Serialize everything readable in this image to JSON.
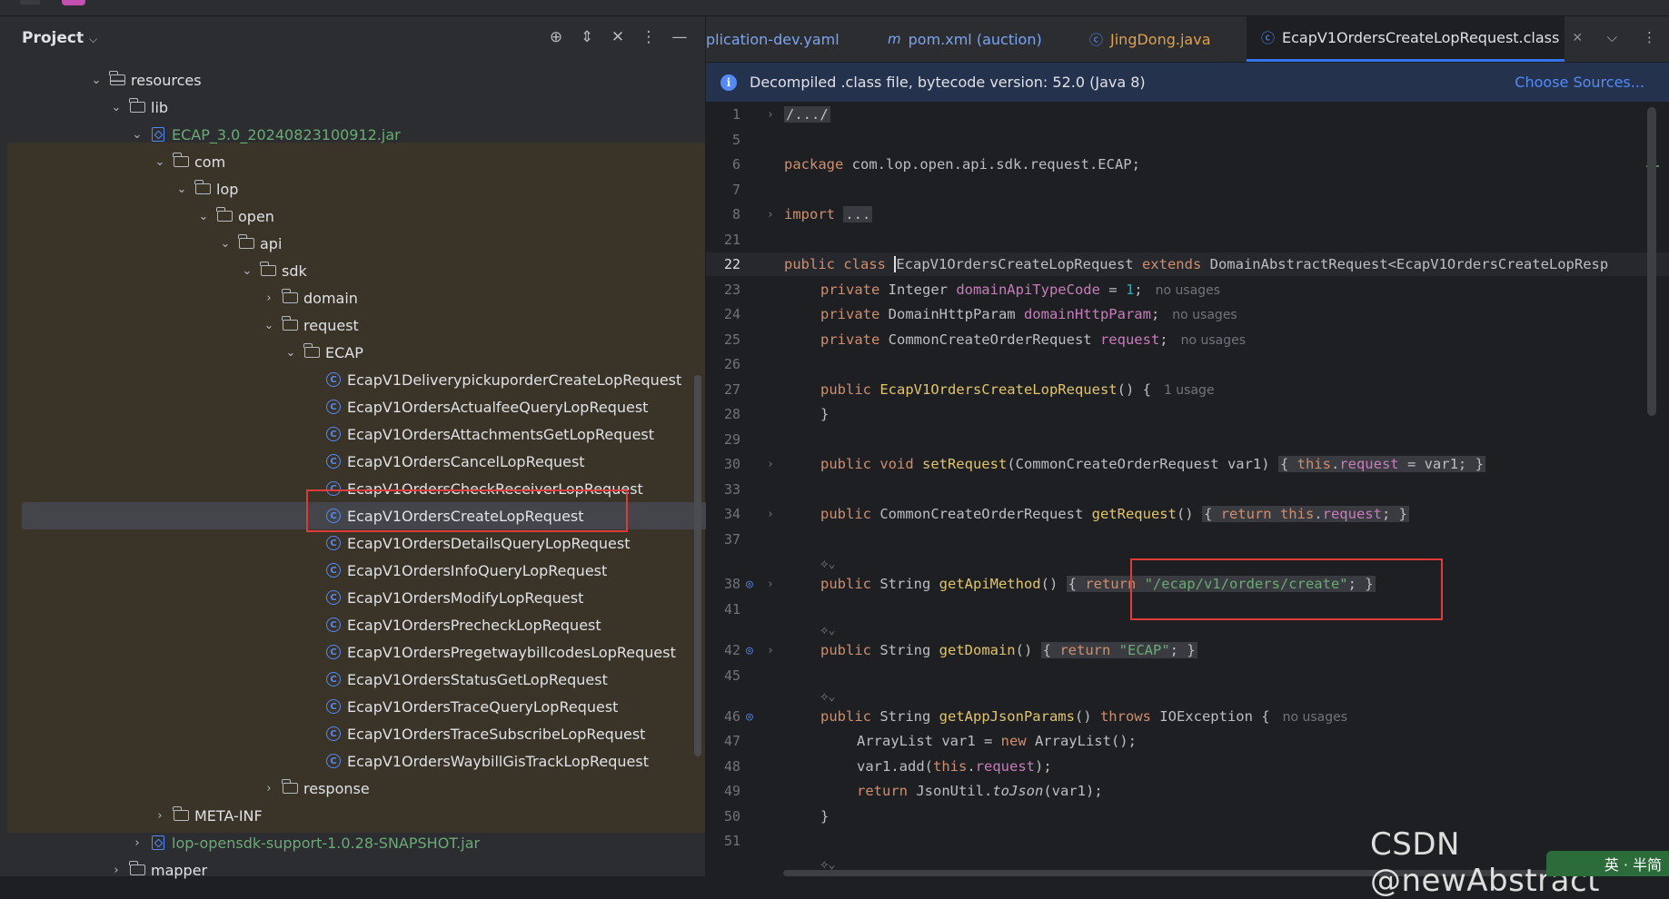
{
  "project_panel": {
    "title": "Project",
    "tree": [
      {
        "label": "resources",
        "icon": "resources-folder-icon",
        "expanded": true
      },
      {
        "label": "lib",
        "icon": "folder-icon",
        "expanded": true
      },
      {
        "label": "ECAP_3.0_20240823100912.jar",
        "icon": "jar-icon",
        "expanded": true
      },
      {
        "label": "com",
        "icon": "folder-icon",
        "expanded": true
      },
      {
        "label": "lop",
        "icon": "folder-icon",
        "expanded": true
      },
      {
        "label": "open",
        "icon": "folder-icon",
        "expanded": true
      },
      {
        "label": "api",
        "icon": "folder-icon",
        "expanded": true
      },
      {
        "label": "sdk",
        "icon": "folder-icon",
        "expanded": true
      },
      {
        "label": "domain",
        "icon": "folder-icon",
        "expanded": false
      },
      {
        "label": "request",
        "icon": "folder-icon",
        "expanded": true
      },
      {
        "label": "ECAP",
        "icon": "folder-icon",
        "expanded": true
      },
      {
        "label": "EcapV1DeliverypickuporderCreateLopRequest",
        "icon": "class-icon"
      },
      {
        "label": "EcapV1OrdersActualfeeQueryLopRequest",
        "icon": "class-icon"
      },
      {
        "label": "EcapV1OrdersAttachmentsGetLopRequest",
        "icon": "class-icon"
      },
      {
        "label": "EcapV1OrdersCancelLopRequest",
        "icon": "class-icon"
      },
      {
        "label": "EcapV1OrdersCheckReceiverLopRequest",
        "icon": "class-icon"
      },
      {
        "label": "EcapV1OrdersCreateLopRequest",
        "icon": "class-icon",
        "selected": true
      },
      {
        "label": "EcapV1OrdersDetailsQueryLopRequest",
        "icon": "class-icon"
      },
      {
        "label": "EcapV1OrdersInfoQueryLopRequest",
        "icon": "class-icon"
      },
      {
        "label": "EcapV1OrdersModifyLopRequest",
        "icon": "class-icon"
      },
      {
        "label": "EcapV1OrdersPrecheckLopRequest",
        "icon": "class-icon"
      },
      {
        "label": "EcapV1OrdersPregetwaybillcodesLopRequest",
        "icon": "class-icon"
      },
      {
        "label": "EcapV1OrdersStatusGetLopRequest",
        "icon": "class-icon"
      },
      {
        "label": "EcapV1OrdersTraceQueryLopRequest",
        "icon": "class-icon"
      },
      {
        "label": "EcapV1OrdersTraceSubscribeLopRequest",
        "icon": "class-icon"
      },
      {
        "label": "EcapV1OrdersWaybillGisTrackLopRequest",
        "icon": "class-icon"
      },
      {
        "label": "response",
        "icon": "folder-icon",
        "expanded": false
      },
      {
        "label": "META-INF",
        "icon": "folder-icon",
        "expanded": false
      },
      {
        "label": "lop-opensdk-support-1.0.28-SNAPSHOT.jar",
        "icon": "jar-icon",
        "expanded": false
      },
      {
        "label": "mapper",
        "icon": "folder-icon",
        "expanded": false
      }
    ]
  },
  "editor": {
    "tabs": [
      {
        "label": "plication-dev.yaml",
        "icon": ""
      },
      {
        "label": "pom.xml (auction)",
        "icon": "maven-icon"
      },
      {
        "label": "JingDong.java",
        "icon": "class-icon"
      },
      {
        "label": "EcapV1OrdersCreateLopRequest.class",
        "icon": "class-icon",
        "active": true
      }
    ],
    "banner_text": "Decompiled .class file, bytecode version: 52.0 (Java 8)",
    "banner_link": "Choose Sources...",
    "line_numbers": [
      "1",
      "5",
      "6",
      "7",
      "8",
      "21",
      "22",
      "23",
      "24",
      "25",
      "26",
      "27",
      "28",
      "29",
      "30",
      "33",
      "34",
      "37",
      "38",
      "41",
      "42",
      "45",
      "46",
      "47",
      "48",
      "49",
      "50",
      "51"
    ],
    "code": {
      "l1": "/.../",
      "l6_kw": "package",
      "l6_rest": " com.lop.open.api.sdk.request.ECAP;",
      "l8_kw": "import",
      "l8_fold": "...",
      "l22_kw": "public class ",
      "l22_name": "EcapV1OrdersCreateLopRequest",
      "l22_ext": " extends ",
      "l22_rest": "DomainAbstractRequest<EcapV1OrdersCreateLopResp",
      "l23_kw": "private ",
      "l23_type": "Integer ",
      "l23_field": "domainApiTypeCode",
      "l23_eq": " = ",
      "l23_num": "1",
      "l23_semi": ";",
      "l23_hint": "no usages",
      "l24_kw": "private ",
      "l24_type": "DomainHttpParam ",
      "l24_field": "domainHttpParam",
      "l24_semi": ";",
      "l24_hint": "no usages",
      "l25_kw": "private ",
      "l25_type": "CommonCreateOrderRequest ",
      "l25_field": "request",
      "l25_semi": ";",
      "l25_hint": "no usages",
      "l27_kw": "public ",
      "l27_fn": "EcapV1OrdersCreateLopRequest",
      "l27_rest": "() {",
      "l27_hint": "1 usage",
      "l28": "}",
      "l30_kw": "public void ",
      "l30_fn": "setRequest",
      "l30_args": "(CommonCreateOrderRequest var1) ",
      "l30_body_open": "{ ",
      "l30_this": "this",
      "l30_dot": ".",
      "l30_field": "request",
      "l30_tail": " = var1; ",
      "l30_close": "}",
      "l34_kw": "public ",
      "l34_type": "CommonCreateOrderRequest ",
      "l34_fn": "getRequest",
      "l34_paren": "() ",
      "l34_open": "{ ",
      "l34_ret": "return this",
      "l34_dot": ".",
      "l34_field": "request",
      "l34_semi": "; ",
      "l34_close": "}",
      "l38_kw": "public ",
      "l38_type": "String ",
      "l38_fn": "getApiMethod",
      "l38_paren": "() ",
      "l38_open": "{ ",
      "l38_ret": "return ",
      "l38_str": "\"/ecap/v1/orders/create\"",
      "l38_semi": "; ",
      "l38_close": "}",
      "l42_kw": "public ",
      "l42_type": "String ",
      "l42_fn": "getDomain",
      "l42_paren": "() ",
      "l42_open": "{ ",
      "l42_ret": "return ",
      "l42_str": "\"ECAP\"",
      "l42_semi": "; ",
      "l42_close": "}",
      "l46_kw": "public ",
      "l46_type": "String ",
      "l46_fn": "getAppJsonParams",
      "l46_paren": "() ",
      "l46_throws": "throws ",
      "l46_rest": "IOException {",
      "l46_hint": "no usages",
      "l47_a": "ArrayList var1 = ",
      "l47_new": "new ",
      "l47_b": "ArrayList();",
      "l48_a": "var1.add(",
      "l48_this": "this",
      "l48_dot": ".",
      "l48_field": "request",
      "l48_b": ");",
      "l49_ret": "return ",
      "l49_a": "JsonUtil.",
      "l49_fn": "toJson",
      "l49_b": "(var1);",
      "l50": "}"
    }
  },
  "watermark": "CSDN @newAbstract",
  "ime_indicator": "英 · 半简"
}
